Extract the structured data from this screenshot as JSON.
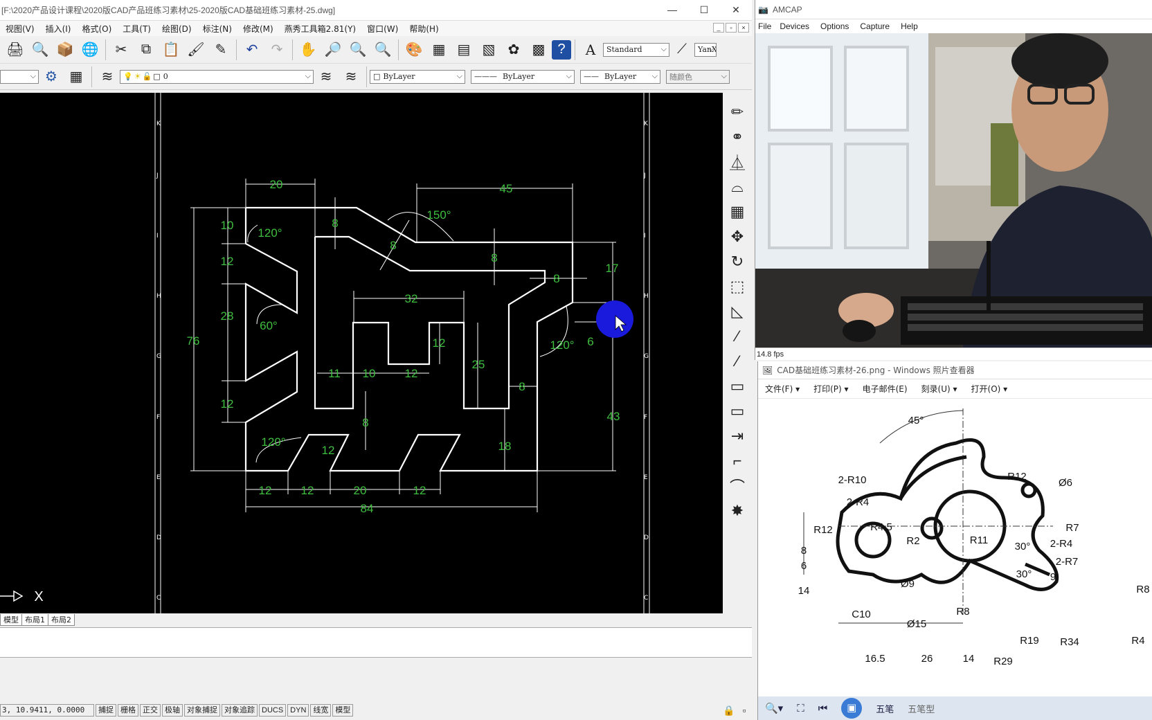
{
  "cad": {
    "title": "[F:\\2020产品设计课程\\2020版CAD产品班练习素材\\25-2020版CAD基础班练习素材-25.dwg]",
    "window_buttons": [
      "—",
      "☐",
      "✕"
    ],
    "menus": [
      "视图(V)",
      "插入(I)",
      "格式(O)",
      "工具(T)",
      "绘图(D)",
      "标注(N)",
      "修改(M)",
      "燕秀工具箱2.81(Y)",
      "窗口(W)",
      "帮助(H)"
    ],
    "mdi_buttons": [
      "_",
      "▫",
      "×"
    ],
    "text_style": "Standard",
    "dim_style": "YanXi",
    "layer_name": "0",
    "color_combo": "ByLayer",
    "linetype_combo": "ByLayer",
    "lineweight_combo": "ByLayer",
    "plot_style": "随颜色",
    "layout_tabs": [
      "模型",
      "布局1",
      "布局2"
    ],
    "coords": "3, 10.9411, 0.0000",
    "status_buttons": [
      "捕捉",
      "栅格",
      "正交",
      "极轴",
      "对象捕捉",
      "对象追踪",
      "DUCS",
      "DYN",
      "线宽",
      "模型"
    ],
    "ruler_letters": [
      "K",
      "J",
      "I",
      "H",
      "G",
      "F",
      "E",
      "D",
      "C"
    ],
    "ucs_label": "X",
    "colors": {
      "canvas": "#000000",
      "geometry": "#ffffff",
      "dimension": "#3fbf3f",
      "cursor": "#1a1adc"
    },
    "dims": {
      "d20top": "20",
      "d45": "45",
      "d150": "150°",
      "d8a": "8",
      "d8b": "8",
      "d10": "10",
      "d120a": "120°",
      "d12a": "12",
      "d8c": "8",
      "d8d": "8",
      "d17": "17",
      "d32": "32",
      "d28": "28",
      "d60": "60°",
      "d76": "76",
      "d12b": "12",
      "d25": "25",
      "d120b": "120°",
      "d6": "6",
      "d11": "11",
      "d10b": "10",
      "d12c": "12",
      "d8e": "8",
      "d12d": "12",
      "d8f": "8",
      "d43": "43",
      "d120c": "120°",
      "d12e": "12",
      "d18": "18",
      "b12a": "12",
      "b12b": "12",
      "b20": "20",
      "b12c": "12",
      "b84": "84"
    }
  },
  "amcap": {
    "title": "AMCAP",
    "menus": [
      "File",
      "Devices",
      "Options",
      "Capture",
      "Help"
    ],
    "fps": "14.8 fps"
  },
  "viewer": {
    "title": "CAD基础班练习素材-26.png - Windows 照片查看器",
    "menus": [
      "文件(F) ▾",
      "打印(P) ▾",
      "电子邮件(E)",
      "刻录(U) ▾",
      "打开(O) ▾"
    ],
    "labels": {
      "a45": "45°",
      "r10": "2-R10",
      "r12a": "R12",
      "phi6": "Ø6",
      "r4a": "2-R4",
      "r12b": "R12",
      "r45": "R4.5",
      "r7": "R7",
      "r2": "R2",
      "r11": "R11",
      "deg30a": "30°",
      "r4b": "2-R4",
      "r7b": "2-R7",
      "deg30b": "30°",
      "v8": "8",
      "v6": "6",
      "v14": "14",
      "phi9": "Ø9",
      "n9": "9",
      "r8a": "R8",
      "c10": "C10",
      "phi15": "Ø15",
      "r8b": "R8",
      "r19": "R19",
      "r34": "R34",
      "r4c": "R4",
      "r29": "R29",
      "h165": "16.5",
      "h26": "26",
      "h14": "14"
    },
    "taskbar": [
      "五笔",
      "五笔型"
    ]
  }
}
